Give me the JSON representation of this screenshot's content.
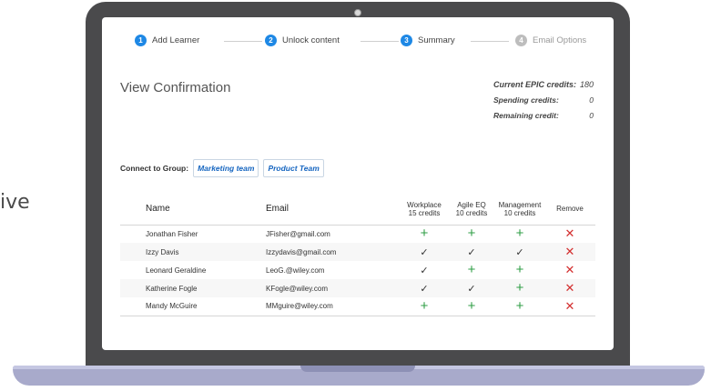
{
  "side_text": "ive",
  "stepper": [
    {
      "num": "1",
      "label": "Add Learner",
      "state": "active"
    },
    {
      "num": "2",
      "label": "Unlock content",
      "state": "active"
    },
    {
      "num": "3",
      "label": "Summary",
      "state": "active"
    },
    {
      "num": "4",
      "label": "Email Options",
      "state": "disabled"
    }
  ],
  "page_title": "View Confirmation",
  "credits": {
    "current_label": "Current EPIC credits:",
    "current_value": "180",
    "spending_label": "Spending credits:",
    "spending_value": "0",
    "remaining_label": "Remaining credit:",
    "remaining_value": "0"
  },
  "group": {
    "label": "Connect to Group:",
    "chips": [
      "Marketing team",
      "Product Team"
    ]
  },
  "table": {
    "headers": {
      "name": "Name",
      "email": "Email",
      "workplace": [
        "Workplace",
        "15 credits"
      ],
      "agile": [
        "Agile EQ",
        "10 credits"
      ],
      "management": [
        "Management",
        "10 credits"
      ],
      "remove": "Remove"
    },
    "rows": [
      {
        "name": "Jonathan Fisher",
        "email": "JFisher@gmail.com",
        "workplace": "plus",
        "agile": "plus",
        "management": "plus"
      },
      {
        "name": "Izzy Davis",
        "email": "Izzydavis@gmail.com",
        "workplace": "check",
        "agile": "check",
        "management": "check"
      },
      {
        "name": "Leonard Geraldine",
        "email": "LeoG.@wiley.com",
        "workplace": "check",
        "agile": "plus",
        "management": "plus"
      },
      {
        "name": "Katherine Fogle",
        "email": "KFogle@wiley.com",
        "workplace": "check",
        "agile": "check",
        "management": "plus"
      },
      {
        "name": "Mandy McGuire",
        "email": "MMguire@wiley.com",
        "workplace": "plus",
        "agile": "plus",
        "management": "plus"
      }
    ]
  },
  "colors": {
    "accent": "#1e88e5",
    "add_green": "#2e9e44",
    "remove_red": "#d32f2f",
    "laptop_frame": "#4a4a4c",
    "laptop_base": "#a8aacb"
  },
  "icons": {
    "plus": "plus-icon",
    "check": "check-icon",
    "remove": "remove-x-icon"
  }
}
